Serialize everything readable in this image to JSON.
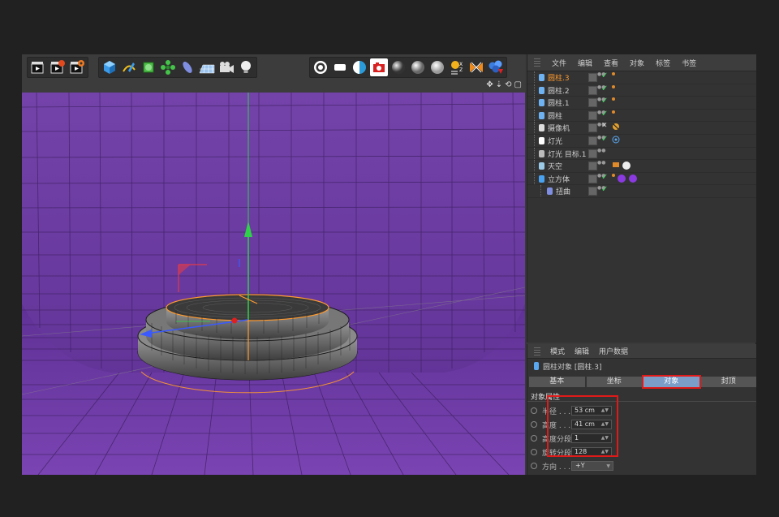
{
  "toolbar": {
    "groups": [
      [
        "render-view-icon",
        "render-picture-viewer-icon",
        "render-settings-icon"
      ],
      [
        "cube-icon",
        "pen-spline-icon",
        "subdivision-icon",
        "cloner-icon",
        "deformer-icon",
        "floor-icon",
        "camera-icon",
        "light-icon"
      ],
      [
        "floor-object-icon",
        "background-object-icon",
        "sky-object-icon",
        "physical-sky-icon",
        "environment-icon",
        "foreground-icon",
        "stage-icon",
        "sun-icon",
        "xref-icon",
        "material-icon"
      ]
    ]
  },
  "viewport": {
    "nav_icons": [
      "move-view-icon",
      "zoom-view-icon",
      "rotate-view-icon",
      "maximize-view-icon"
    ]
  },
  "object_manager": {
    "menu": [
      "文件",
      "编辑",
      "查看",
      "对象",
      "标签",
      "书签"
    ],
    "objects": [
      {
        "name": "圆柱.3",
        "icon": "cylinder-icon",
        "active": true,
        "check": "✓",
        "indent": 1
      },
      {
        "name": "圆柱.2",
        "icon": "cylinder-icon",
        "active": false,
        "check": "✓",
        "indent": 1
      },
      {
        "name": "圆柱.1",
        "icon": "cylinder-icon",
        "active": false,
        "check": "✓",
        "indent": 1
      },
      {
        "name": "圆柱",
        "icon": "cylinder-icon",
        "active": false,
        "check": "✓",
        "indent": 1
      },
      {
        "name": "摄像机",
        "icon": "camera-icon",
        "active": false,
        "check": "✕",
        "indent": 1
      },
      {
        "name": "灯光",
        "icon": "light-icon",
        "active": false,
        "check": "✓",
        "indent": 1
      },
      {
        "name": "灯光 目标.1",
        "icon": "null-icon",
        "active": false,
        "check": "",
        "indent": 1
      },
      {
        "name": "天空",
        "icon": "sky-icon",
        "active": false,
        "check": "",
        "indent": 1
      },
      {
        "name": "立方体",
        "icon": "cube-icon",
        "active": false,
        "check": "✓",
        "indent": 0
      },
      {
        "name": "扭曲",
        "icon": "bend-icon",
        "active": false,
        "check": "✓",
        "indent": 2
      }
    ]
  },
  "attribute_manager": {
    "menu": [
      "模式",
      "编辑",
      "用户数据"
    ],
    "title": "圆柱对象 [圆柱.3]",
    "tabs": [
      {
        "label": "基本",
        "active": false
      },
      {
        "label": "坐标",
        "active": false
      },
      {
        "label": "对象",
        "active": true
      },
      {
        "label": "封顶",
        "active": false
      }
    ],
    "section": "对象属性",
    "properties": [
      {
        "label": "半径 . . .",
        "value": "53 cm"
      },
      {
        "label": "高度 . . .",
        "value": "41 cm"
      },
      {
        "label": "高度分段",
        "value": "1"
      },
      {
        "label": "旋转分段",
        "value": "128"
      }
    ],
    "direction": {
      "label": "方向 . . .",
      "value": "+Y"
    }
  },
  "colors": {
    "viewport_bg": "#6d3aa1",
    "highlight": "#e01919",
    "active_object": "#ff9a2e",
    "active_tab": "#7b9ec9"
  }
}
